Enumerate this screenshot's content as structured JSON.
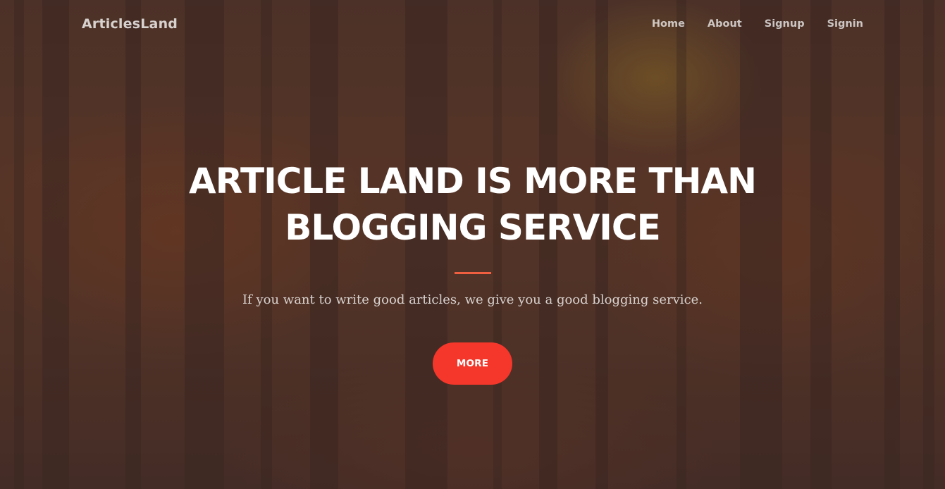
{
  "navbar": {
    "brand": "ArticlesLand",
    "links": [
      {
        "label": "Home"
      },
      {
        "label": "About"
      },
      {
        "label": "Signup"
      },
      {
        "label": "Signin"
      }
    ]
  },
  "hero": {
    "heading_line1": "ARTICLE LAND IS MORE THAN",
    "heading_line2": "BLOGGING SERVICE",
    "subtitle": "If you want to write good articles, we give you a good blogging service.",
    "button_label": "MORE"
  },
  "colors": {
    "accent": "#f5372b",
    "divider": "#f05f40",
    "overlay": "#3c2823"
  }
}
